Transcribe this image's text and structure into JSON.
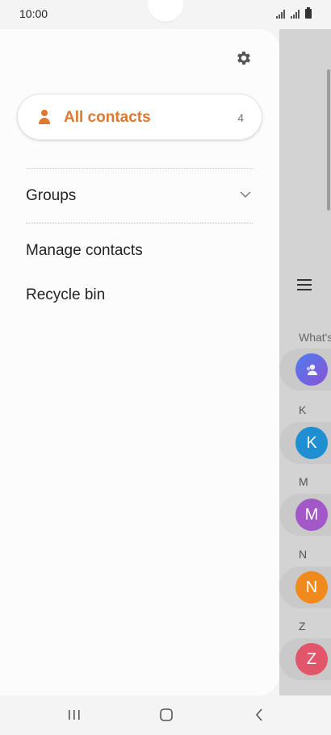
{
  "status_bar": {
    "time": "10:00"
  },
  "drawer": {
    "all_contacts": {
      "label": "All contacts",
      "count": "4",
      "accent": "#e0772f"
    },
    "groups_label": "Groups",
    "manage_contacts_label": "Manage contacts",
    "recycle_bin_label": "Recycle bin"
  },
  "background_list": {
    "section_label": "What's",
    "entries": [
      {
        "letter": "",
        "initial": "",
        "color": "#6a5bd8"
      },
      {
        "letter": "K",
        "initial": "K",
        "color": "#1f8fd1"
      },
      {
        "letter": "M",
        "initial": "M",
        "color": "#a358c7"
      },
      {
        "letter": "N",
        "initial": "N",
        "color": "#f08a1c"
      },
      {
        "letter": "Z",
        "initial": "Z",
        "color": "#e2566b"
      }
    ]
  },
  "icons": {
    "settings": "gear-icon",
    "all_contacts": "person-icon",
    "groups_expand": "chevron-down-icon",
    "nav_recents": "recents-icon",
    "nav_home": "home-icon",
    "nav_back": "back-icon"
  }
}
